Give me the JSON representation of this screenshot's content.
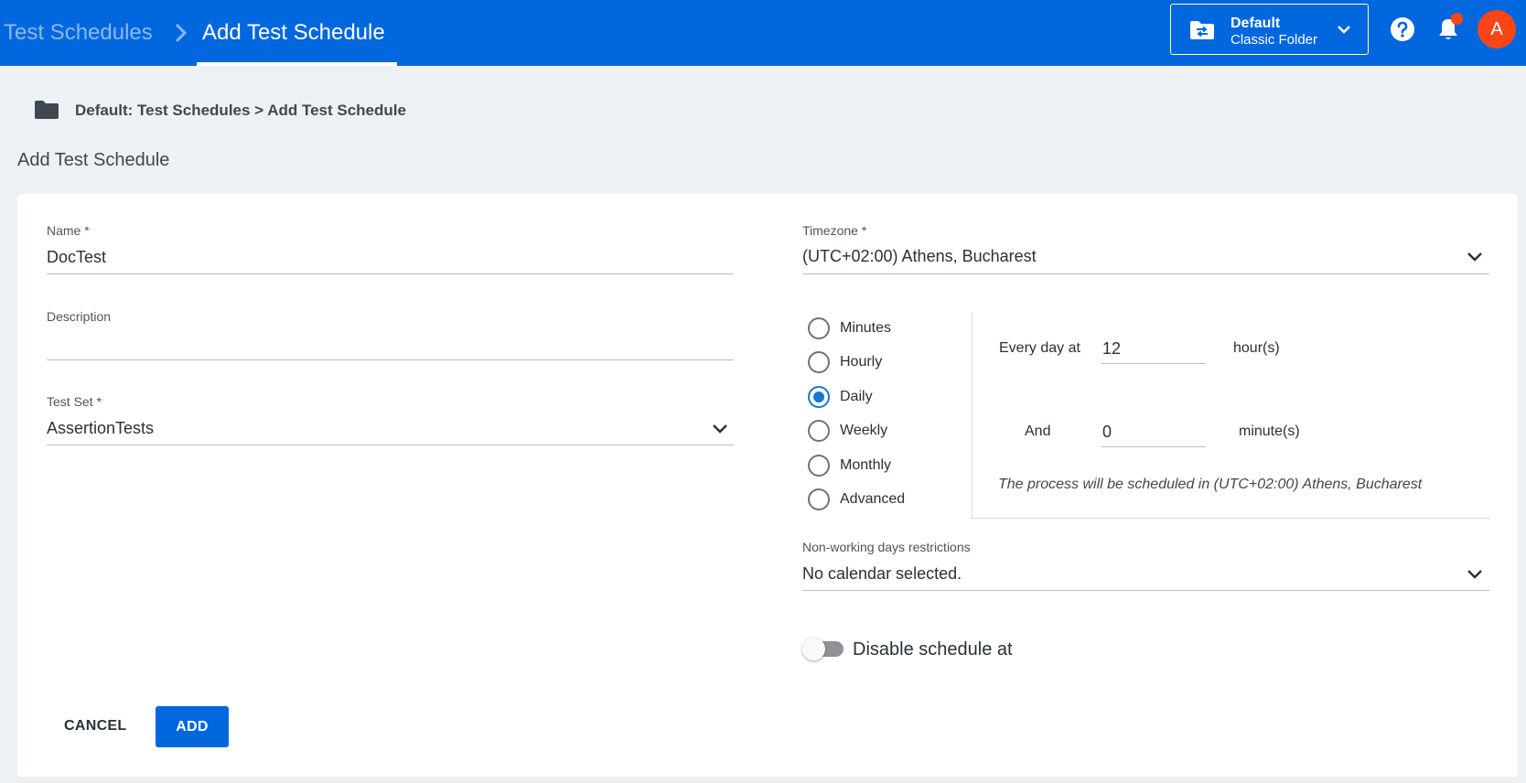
{
  "header": {
    "breadcrumb_parent": "Test Schedules",
    "breadcrumb_current": "Add Test Schedule",
    "folder_name": "Default",
    "folder_type": "Classic Folder",
    "avatar_initial": "A",
    "icons": [
      "folder-switch-icon",
      "chevron-down-icon",
      "help-icon",
      "bell-icon"
    ],
    "colors": {
      "bar": "#0067df",
      "accent": "#fa4616"
    }
  },
  "page": {
    "breadcrumb": "Default: Test Schedules > Add Test Schedule",
    "title": "Add Test Schedule"
  },
  "form": {
    "name": {
      "label": "Name *",
      "value": "DocTest"
    },
    "description": {
      "label": "Description",
      "value": ""
    },
    "test_set": {
      "label": "Test Set *",
      "value": "AssertionTests"
    },
    "timezone": {
      "label": "Timezone *",
      "value": "(UTC+02:00) Athens, Bucharest"
    },
    "frequency": {
      "options": [
        "Minutes",
        "Hourly",
        "Daily",
        "Weekly",
        "Monthly",
        "Advanced"
      ],
      "selected": "Daily"
    },
    "daily": {
      "every_day_at_label": "Every day at",
      "hours_value": "12",
      "hours_unit": "hour(s)",
      "and_label": "And",
      "minutes_value": "0",
      "minutes_unit": "minute(s)",
      "note": "The process will be scheduled in (UTC+02:00) Athens, Bucharest"
    },
    "non_working_days": {
      "label": "Non-working days restrictions",
      "value": "No calendar selected."
    },
    "disable_schedule": {
      "label": "Disable schedule at",
      "enabled": false
    }
  },
  "actions": {
    "cancel_label": "CANCEL",
    "add_label": "ADD"
  }
}
